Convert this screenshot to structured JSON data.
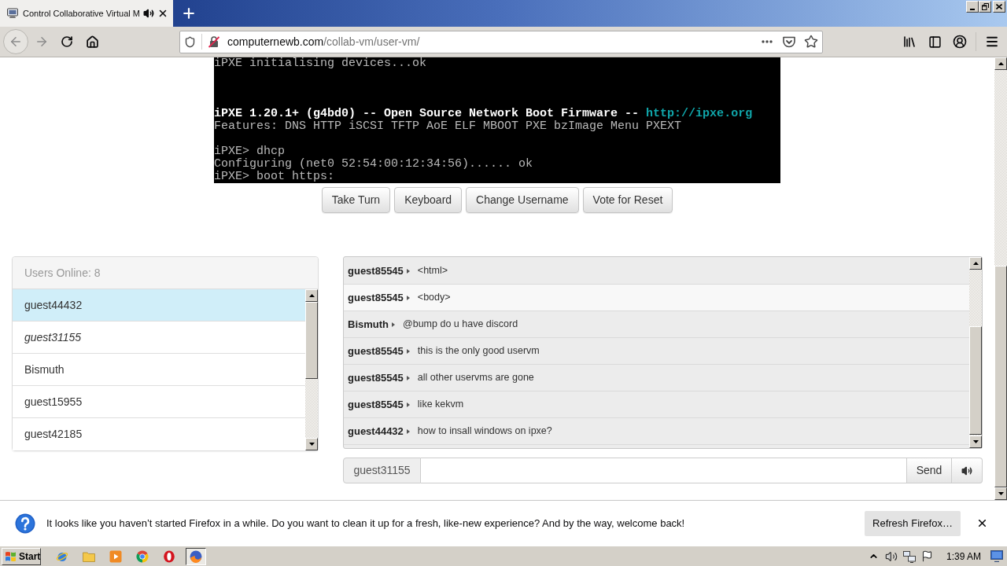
{
  "browser": {
    "tab": {
      "title": "Control Collaborative Virtual M",
      "audio_playing": true
    },
    "url": {
      "host": "computernewb.com",
      "path": "/collab-vm/user-vm/"
    }
  },
  "vm_screen": {
    "lines": [
      {
        "kind": "text",
        "text": "iPXE initialising devices...ok"
      },
      {
        "kind": "blank"
      },
      {
        "kind": "blank"
      },
      {
        "kind": "blank"
      },
      {
        "kind": "banner",
        "text": "iPXE 1.20.1+ (g4bd0) -- Open Source Network Boot Firmware --",
        "link": "http://ipxe.org"
      },
      {
        "kind": "text",
        "text": "Features: DNS HTTP iSCSI TFTP AoE ELF MBOOT PXE bzImage Menu PXEXT"
      },
      {
        "kind": "blank"
      },
      {
        "kind": "text",
        "text": "iPXE> dhcp"
      },
      {
        "kind": "text",
        "text": "Configuring (net0 52:54:00:12:34:56)...... ok"
      },
      {
        "kind": "text",
        "text": "iPXE> boot https:"
      }
    ]
  },
  "vm_buttons": [
    "Take Turn",
    "Keyboard",
    "Change Username",
    "Vote for Reset"
  ],
  "users": {
    "title": "Users Online: 8",
    "items": [
      {
        "name": "guest44432",
        "selected": true,
        "self": false
      },
      {
        "name": "guest31155",
        "selected": false,
        "self": true
      },
      {
        "name": "Bismuth",
        "selected": false,
        "self": false
      },
      {
        "name": "guest15955",
        "selected": false,
        "self": false
      },
      {
        "name": "guest42185",
        "selected": false,
        "self": false
      }
    ]
  },
  "chat": {
    "messages": [
      {
        "user": "guest85545",
        "text": "<html>",
        "highlighted": false
      },
      {
        "user": "guest85545",
        "text": "<body>",
        "highlighted": true
      },
      {
        "user": "Bismuth",
        "text": "@bump do u have discord",
        "highlighted": false
      },
      {
        "user": "guest85545",
        "text": "this is the only good uservm",
        "highlighted": false
      },
      {
        "user": "guest85545",
        "text": "all other uservms are gone",
        "highlighted": false
      },
      {
        "user": "guest85545",
        "text": "like kekvm",
        "highlighted": false
      },
      {
        "user": "guest44432",
        "text": "how to insall windows on ipxe?",
        "highlighted": false
      }
    ],
    "username": "guest31155",
    "send": "Send"
  },
  "notification": {
    "text": "It looks like you haven’t started Firefox in a while. Do you want to clean it up for a fresh, like-new experience? And by the way, welcome back!",
    "button": "Refresh Firefox…"
  },
  "taskbar": {
    "start": "Start",
    "apps": [
      {
        "kind": "orbit",
        "active": false
      },
      {
        "kind": "folder",
        "active": false
      },
      {
        "kind": "player",
        "active": false
      },
      {
        "kind": "segmented",
        "active": false
      },
      {
        "kind": "ring",
        "active": false
      },
      {
        "kind": "flame",
        "active": true
      }
    ],
    "clock": "1:39 AM"
  }
}
